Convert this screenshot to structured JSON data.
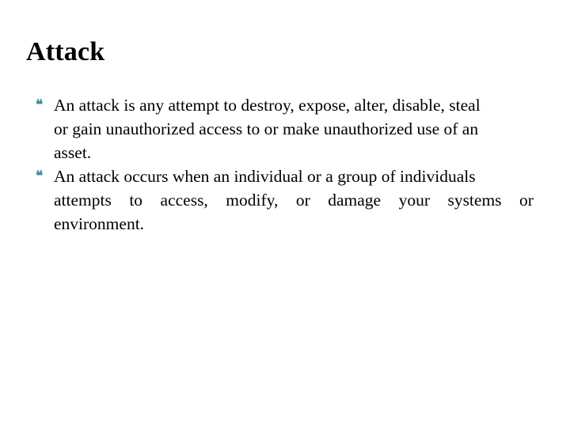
{
  "slide": {
    "title": "Attack",
    "background_color": "#ffffff",
    "text_color": "#000000",
    "bullet_color": "#4a8f99",
    "bullet_glyph": "❝",
    "bullets": [
      {
        "id": "attack-definition",
        "marker": "❝",
        "lines": [
          "An attack is any attempt to destroy, expose, alter, disable, steal",
          "or gain unauthorized access to or make unauthorized use of an",
          "asset."
        ],
        "full_text": "An attack is any attempt to destroy, expose, alter, disable, steal or gain unauthorized access to or make unauthorized use of an asset."
      },
      {
        "id": "attack-occurrence",
        "marker": "❝",
        "lines": [
          "An attack occurs when an individual or a group of individuals",
          "attempts to access, modify, or damage your systems or",
          "environment."
        ],
        "full_text": "An attack occurs when an individual or a group of individuals attempts to access, modify, or damage your systems or environment.",
        "justified_line_words": [
          "attempts",
          "to",
          "access,",
          "modify,",
          "or",
          "damage",
          "your",
          "systems",
          "or"
        ]
      }
    ]
  }
}
